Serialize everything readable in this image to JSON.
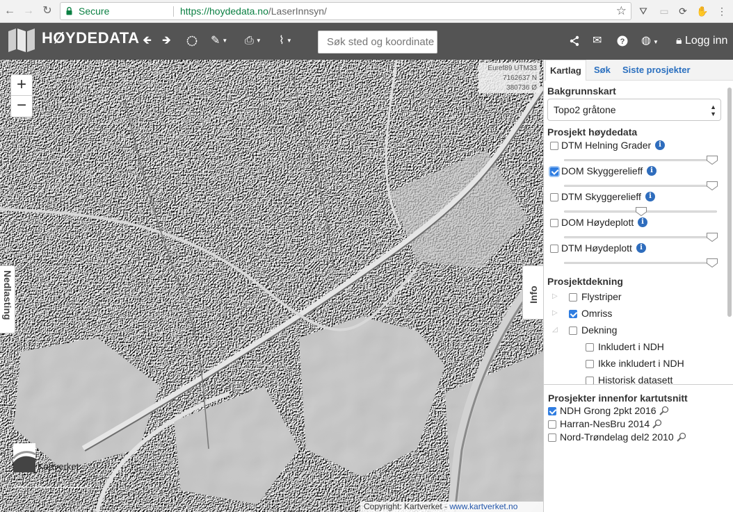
{
  "browser": {
    "secure_label": "Secure",
    "url_host": "https://hoydedata.no",
    "url_path": "/LaserInnsyn/"
  },
  "header": {
    "title": "HØYDEDATA",
    "search_placeholder": "Søk sted og koordinate",
    "login_label": "Logg inn"
  },
  "map": {
    "coords": {
      "system": "Euref89 UTM33",
      "north": "7162637 N",
      "east": "380736 Ø"
    },
    "zoom_in": "+",
    "zoom_out": "−",
    "left_tab": "Nedlasting",
    "right_tab": "Info",
    "logo_label": "Kartverket",
    "copyright_text": "Copyright: Kartverket - ",
    "copyright_link": "www.kartverket.no"
  },
  "panel": {
    "tabs": [
      "Kartlag",
      "Søk",
      "Siste prosjekter"
    ],
    "background_heading": "Bakgrunnskart",
    "background_selected": "Topo2 gråtone",
    "project_heading": "Prosjekt høydedata",
    "layers": [
      {
        "label": "DTM Helning Grader",
        "checked": false,
        "opacity": 1.0
      },
      {
        "label": "DOM Skyggerelieff",
        "checked": true,
        "opacity": 1.0
      },
      {
        "label": "DTM Skyggerelieff",
        "checked": false,
        "opacity": 0.5
      },
      {
        "label": "DOM Høydeplott",
        "checked": false,
        "opacity": 1.0
      },
      {
        "label": "DTM Høydeplott",
        "checked": false,
        "opacity": 1.0
      }
    ],
    "coverage_heading": "Prosjektdekning",
    "coverage": [
      {
        "label": "Flystriper",
        "checked": false
      },
      {
        "label": "Omriss",
        "checked": true
      },
      {
        "label": "Dekning",
        "checked": false
      }
    ],
    "coverage_sub": [
      {
        "label": "Inkludert i NDH",
        "checked": false
      },
      {
        "label": "Ikke inkludert i NDH",
        "checked": false
      },
      {
        "label": "Historisk datasett",
        "checked": false
      }
    ],
    "projects_heading": "Prosjekter innenfor kartutsnitt",
    "projects": [
      {
        "label": "NDH Grong 2pkt 2016",
        "checked": true
      },
      {
        "label": "Harran-NesBru 2014",
        "checked": false
      },
      {
        "label": "Nord-Trøndelag del2 2010",
        "checked": false
      }
    ]
  }
}
